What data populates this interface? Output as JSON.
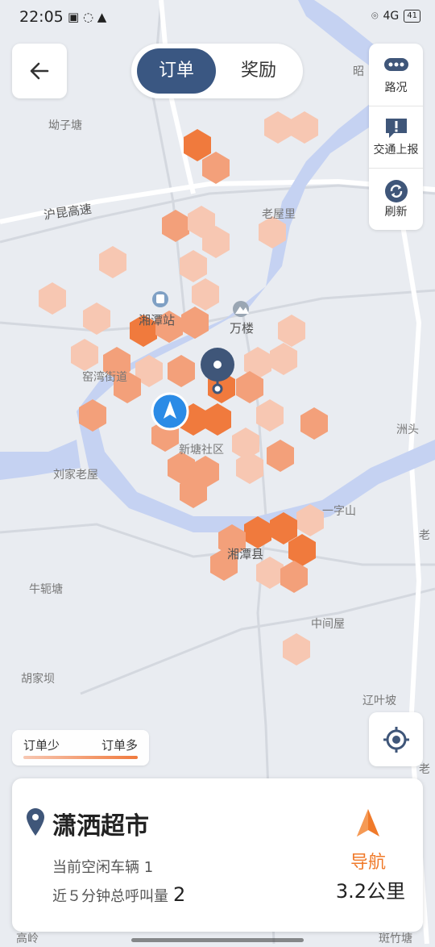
{
  "status_bar": {
    "time": "22:05",
    "network": "4G",
    "battery": "41"
  },
  "tabs": [
    {
      "label": "订单"
    },
    {
      "label": "奖励"
    }
  ],
  "side_panel": {
    "items": [
      {
        "label": "路况",
        "icon": "traffic-icon"
      },
      {
        "label": "交通上报",
        "icon": "report-icon"
      },
      {
        "label": "刷新",
        "icon": "refresh-icon"
      }
    ]
  },
  "map": {
    "road_labels": [
      "沪昆高速",
      "沪昆高速"
    ],
    "place_labels": [
      "坳子塘",
      "老屋里",
      "湘潭站",
      "万楼",
      "窑湾街道",
      "新塘社区",
      "刘家老屋",
      "一字山",
      "湘潭县",
      "牛轭塘",
      "中间屋",
      "胡家坝",
      "辽叶坡",
      "洲头",
      "昭",
      "老",
      "老",
      "高岭",
      "斑竹塘"
    ]
  },
  "legend": {
    "low_label": "订单少",
    "high_label": "订单多",
    "low_color": "#f7c7b2",
    "high_color": "#f07a3d"
  },
  "destination_card": {
    "title": "潇洒超市",
    "idle_vehicles_text": "当前空闲车辆 1",
    "calls_label": "近５分钟总呼叫量",
    "calls_value": "2",
    "nav_label": "导航",
    "distance": "3.2公里"
  },
  "colors": {
    "accent": "#3a5782",
    "orange": "#f07a2a",
    "user_location": "#2b8be6"
  }
}
